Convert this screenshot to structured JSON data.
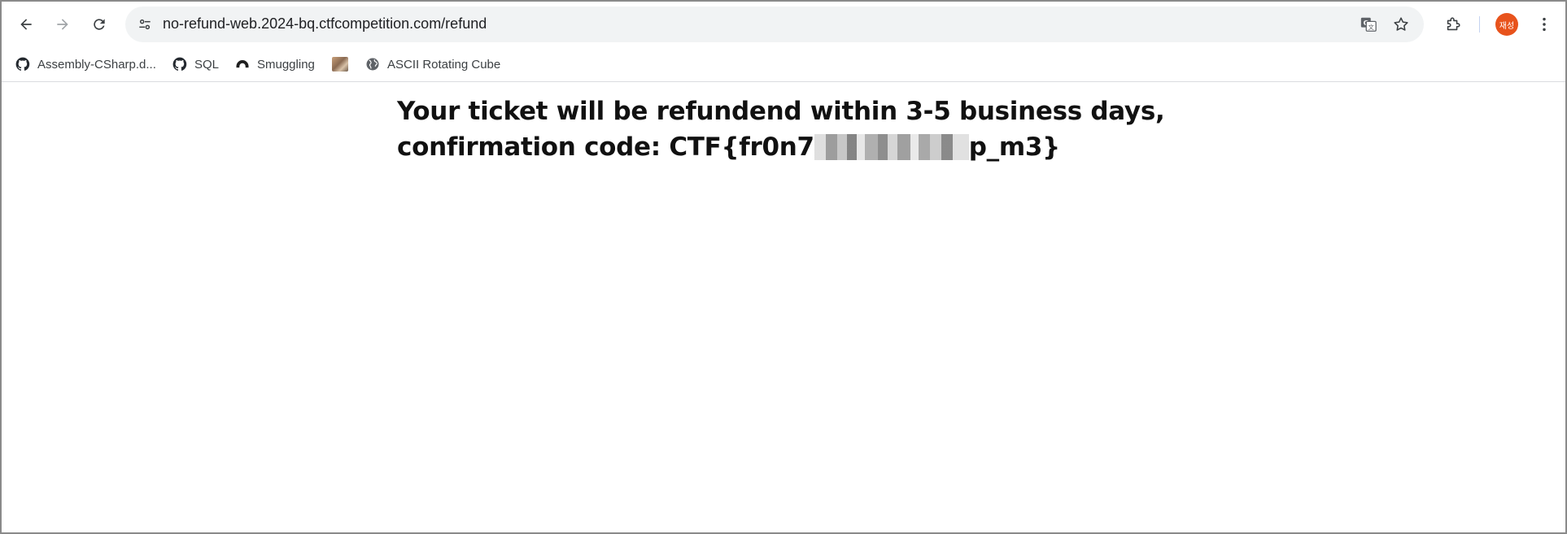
{
  "toolbar": {
    "url": "no-refund-web.2024-bq.ctfcompetition.com/refund",
    "avatar_text": "재성",
    "avatar_color": "#e8531c"
  },
  "bookmarks": [
    {
      "label": "Assembly-CSharp.d...",
      "icon": "github-icon"
    },
    {
      "label": "SQL",
      "icon": "github-icon"
    },
    {
      "label": "Smuggling",
      "icon": "smuggling-icon"
    },
    {
      "label": "",
      "icon": "image-thumbnail-icon"
    },
    {
      "label": "ASCII Rotating Cube",
      "icon": "globe-icon"
    }
  ],
  "page": {
    "line1": "Your ticket will be refundend within 3-5 business days,",
    "line2_prefix": "confirmation code: CTF{fr0n7",
    "line2_suffix": "p_m3}"
  }
}
